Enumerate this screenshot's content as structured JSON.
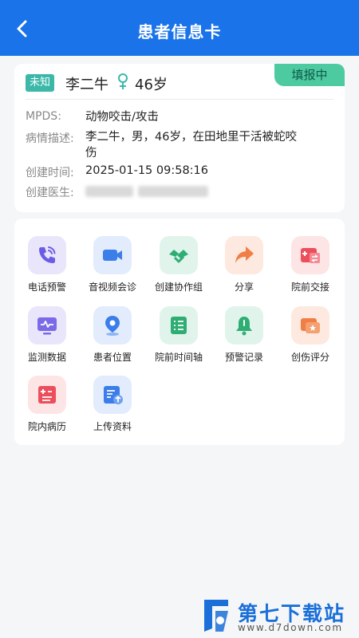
{
  "header": {
    "title": "患者信息卡"
  },
  "patient": {
    "unknown_tag": "未知",
    "name": "李二牛",
    "age": "46岁",
    "status": "填报中",
    "mpds_label": "MPDS:",
    "mpds_value": "动物咬击/攻击",
    "desc_label": "病情描述:",
    "desc_value": "李二牛，男，46岁，在田地里干活被蛇咬伤",
    "created_time_label": "创建时间:",
    "created_time_value": "2025-01-15 09:58:16",
    "doctor_label": "创建医生:"
  },
  "actions": [
    {
      "label": "电话预警",
      "icon": "phone-icon",
      "bg": "#e9e6fb",
      "color": "#6b5ce7"
    },
    {
      "label": "音视频会诊",
      "icon": "video-icon",
      "bg": "#e3ecfc",
      "color": "#3b7de9"
    },
    {
      "label": "创建协作组",
      "icon": "handshake-icon",
      "bg": "#e1f4ec",
      "color": "#2fae74"
    },
    {
      "label": "分享",
      "icon": "share-icon",
      "bg": "#fde9df",
      "color": "#f07e45"
    },
    {
      "label": "院前交接",
      "icon": "transfer-icon",
      "bg": "#fde5e6",
      "color": "#ec4e5c"
    },
    {
      "label": "监测数据",
      "icon": "monitor-icon",
      "bg": "#e9e6fb",
      "color": "#7a6ae8"
    },
    {
      "label": "患者位置",
      "icon": "location-icon",
      "bg": "#e3ecfc",
      "color": "#3b7de9"
    },
    {
      "label": "院前时间轴",
      "icon": "timeline-icon",
      "bg": "#e1f4ec",
      "color": "#2fae74"
    },
    {
      "label": "预警记录",
      "icon": "bell-icon",
      "bg": "#e1f4ec",
      "color": "#2fae74"
    },
    {
      "label": "创伤评分",
      "icon": "score-icon",
      "bg": "#fde9df",
      "color": "#f07e45"
    },
    {
      "label": "院内病历",
      "icon": "medical-record-icon",
      "bg": "#fde5e6",
      "color": "#ec4e5c"
    },
    {
      "label": "上传资料",
      "icon": "upload-icon",
      "bg": "#e3ecfc",
      "color": "#3b7de9"
    }
  ],
  "watermark": {
    "text": "第七下载站",
    "url": "www.d7down.com",
    "color": "#1a6fd8"
  }
}
